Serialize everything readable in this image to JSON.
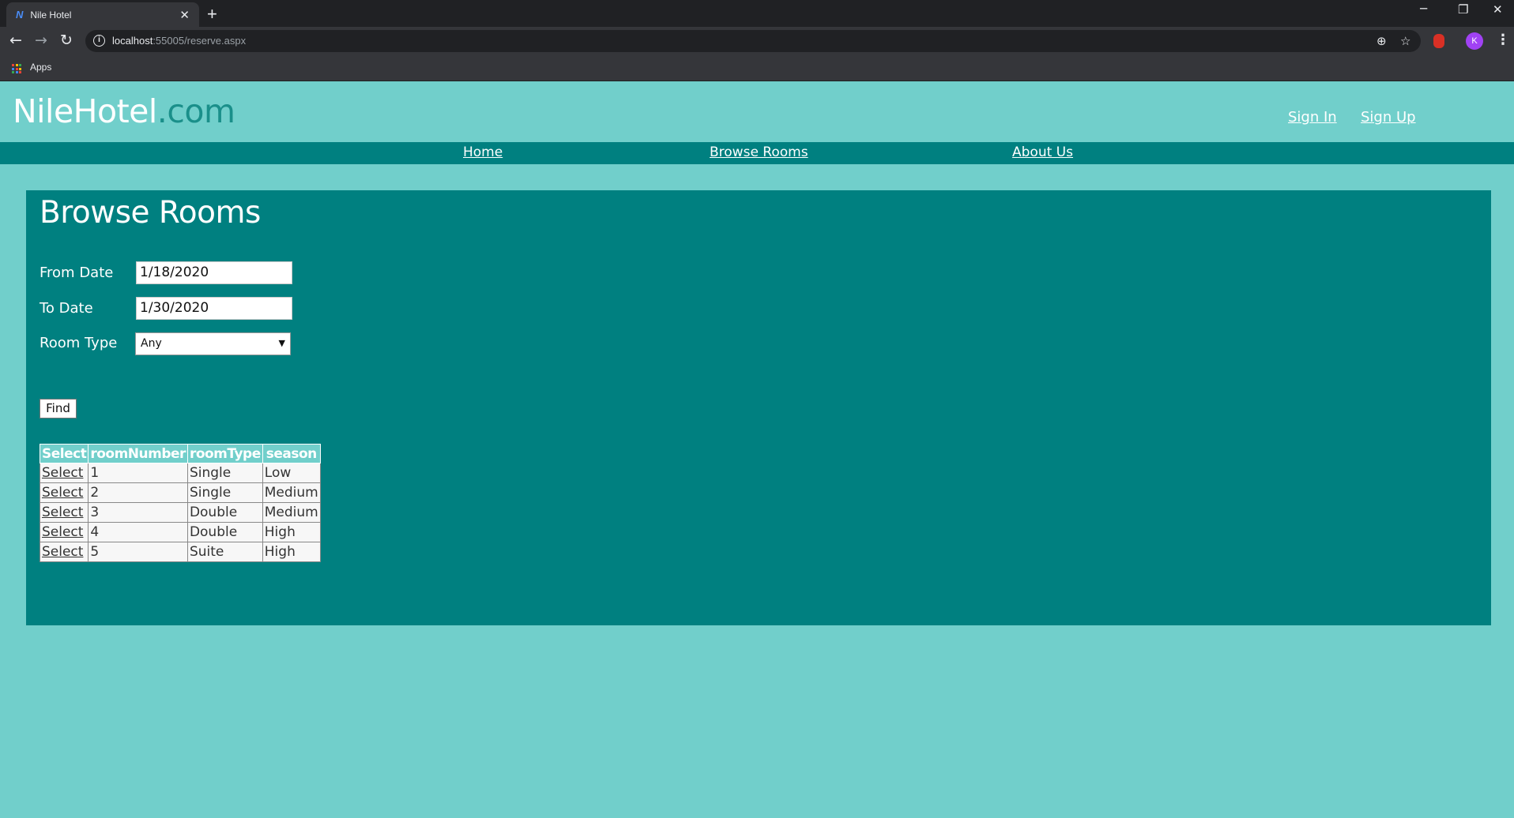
{
  "browser": {
    "tab_title": "Nile Hotel",
    "tab_favicon": "N",
    "tab_close": "✕",
    "new_tab": "+",
    "url_host": "localhost",
    "url_path": ":55005/reserve.aspx",
    "bookmarks_apps": "Apps",
    "profile_initial": "K"
  },
  "header": {
    "logo_main": "NileHotel",
    "logo_suffix": ".com",
    "sign_in": "Sign In",
    "sign_up": "Sign Up"
  },
  "nav": {
    "home": "Home",
    "browse_rooms": "Browse Rooms",
    "about_us": "About Us"
  },
  "form": {
    "title": "Browse Rooms",
    "from_label": "From Date",
    "from_value": "1/18/2020",
    "to_label": "To Date",
    "to_value": "1/30/2020",
    "room_type_label": "Room Type",
    "room_type_value": "Any",
    "find_label": "Find"
  },
  "table": {
    "headers": [
      "Select",
      "roomNumber",
      "roomType",
      "season"
    ],
    "rows": [
      {
        "select": "Select",
        "number": "1",
        "type": "Single",
        "season": "Low"
      },
      {
        "select": "Select",
        "number": "2",
        "type": "Single",
        "season": "Medium"
      },
      {
        "select": "Select",
        "number": "3",
        "type": "Double",
        "season": "Medium"
      },
      {
        "select": "Select",
        "number": "4",
        "type": "Double",
        "season": "High"
      },
      {
        "select": "Select",
        "number": "5",
        "type": "Suite",
        "season": "High"
      }
    ]
  },
  "colors": {
    "page_bg": "#71cfcb",
    "nav_bg": "#008080",
    "panel_bg": "#008080",
    "logo_suffix": "#1a8f8a"
  }
}
